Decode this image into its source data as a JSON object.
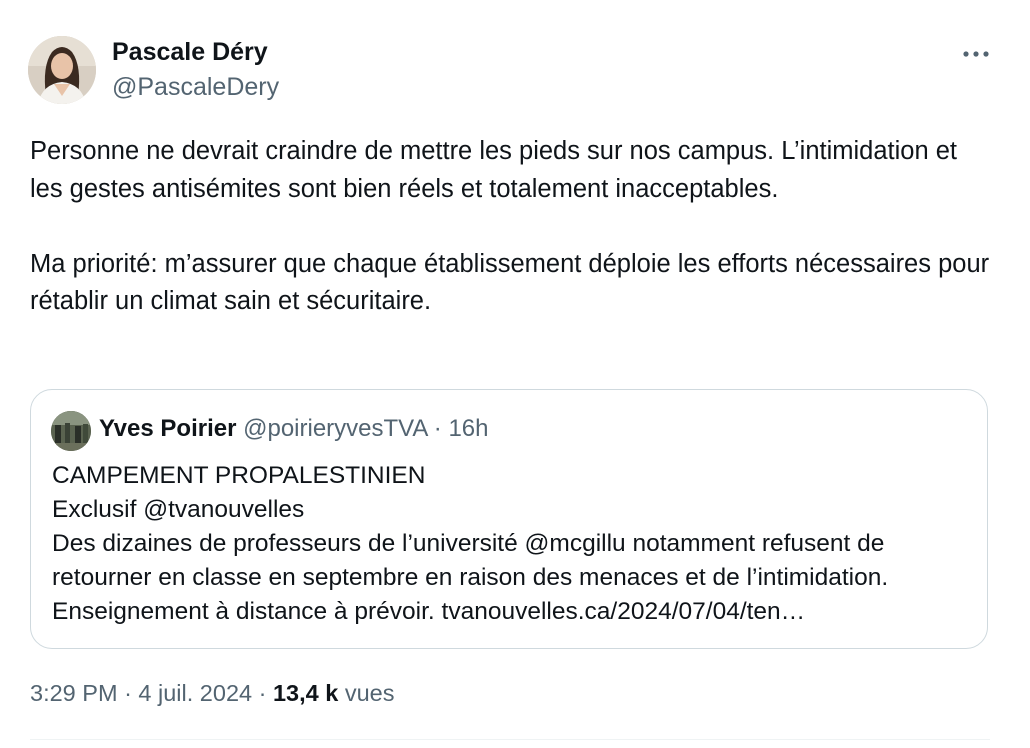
{
  "author": {
    "name": "Pascale Déry",
    "handle": "@PascaleDery"
  },
  "icons": {
    "more": "more-options-icon",
    "avatar": "profile-photo"
  },
  "tweet": {
    "paragraphs": [
      "Personne ne devrait craindre de mettre les pieds sur nos campus. L’intimidation et les gestes antisémites sont bien réels et totalement inacceptables.",
      "Ma priorité: m’assurer que chaque établissement déploie les efforts nécessaires pour rétablir un climat sain et sécuritaire."
    ]
  },
  "quoted_tweet": {
    "name": "Yves Poirier",
    "handle": "@poirieryvesTVA",
    "separator": "·",
    "time_ago": "16h",
    "lines": [
      "CAMPEMENT PROPALESTINIEN",
      "Exclusif @tvanouvelles",
      "Des dizaines de professeurs de l’université @mcgillu notamment refusent de",
      "retourner en classe en septembre en raison des menaces et de l’intimidation.",
      "Enseignement à distance à prévoir. tvanouvelles.ca/2024/07/04/ten…"
    ]
  },
  "meta": {
    "time": "3:29 PM",
    "separator": "·",
    "date": "4 juil. 2024",
    "views_count": "13,4 k",
    "views_label": "vues"
  },
  "colors": {
    "text_primary": "#0f1419",
    "text_secondary": "#536471",
    "border": "#cfd9de"
  }
}
